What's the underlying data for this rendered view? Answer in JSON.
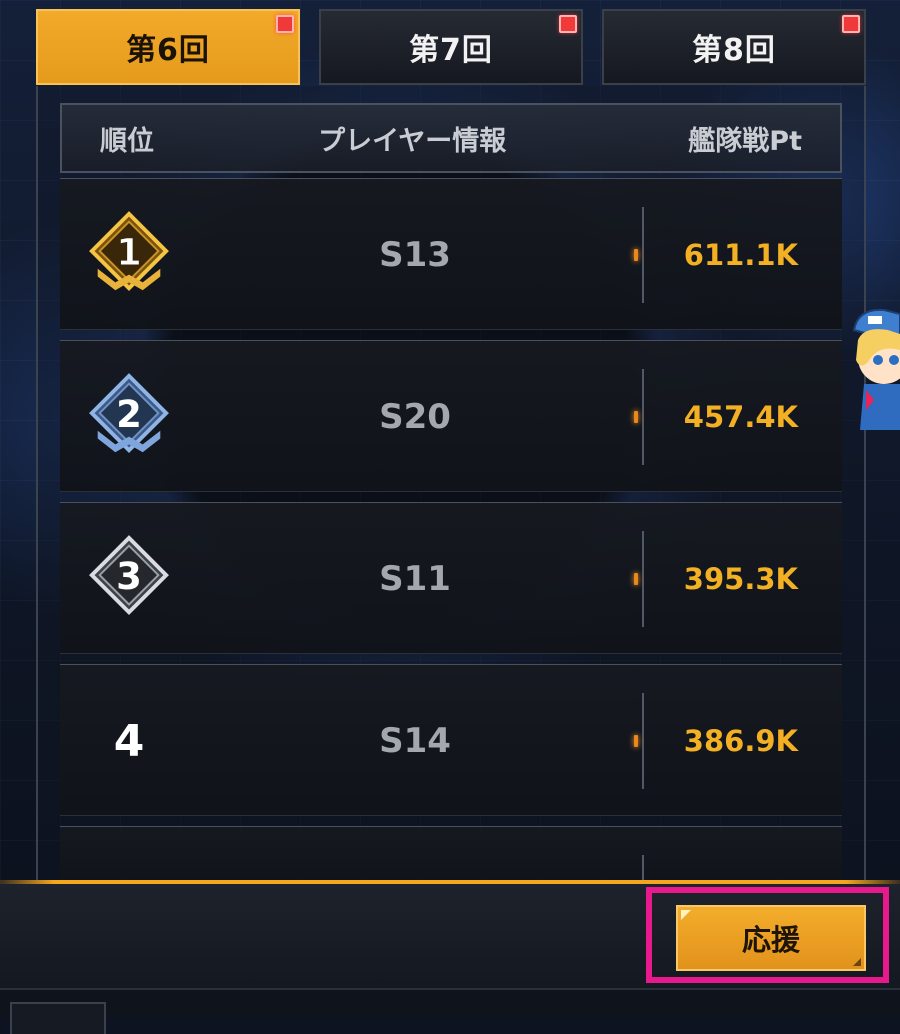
{
  "tabs": [
    {
      "label": "第6回",
      "active": true
    },
    {
      "label": "第7回",
      "active": false
    },
    {
      "label": "第8回",
      "active": false
    }
  ],
  "table": {
    "headers": {
      "rank": "順位",
      "player": "プレイヤー情報",
      "points": "艦隊戦Pt"
    },
    "rows": [
      {
        "rank": "1",
        "medal": "gold",
        "server": "S13",
        "points": "611.1K"
      },
      {
        "rank": "2",
        "medal": "blue",
        "server": "S20",
        "points": "457.4K"
      },
      {
        "rank": "3",
        "medal": "silver",
        "server": "S11",
        "points": "395.3K"
      },
      {
        "rank": "4",
        "medal": "none",
        "server": "S14",
        "points": "386.9K"
      }
    ]
  },
  "actions": {
    "support_label": "応援"
  },
  "colors": {
    "accent": "#f2aa2a",
    "points": "#f3b023",
    "highlight": "#e7198c",
    "notify": "#f03a3a"
  },
  "icons": [
    "notification-dot-icon",
    "gold-rank-medal-icon",
    "blue-rank-medal-icon",
    "silver-rank-medal-icon",
    "mascot-character-icon"
  ]
}
